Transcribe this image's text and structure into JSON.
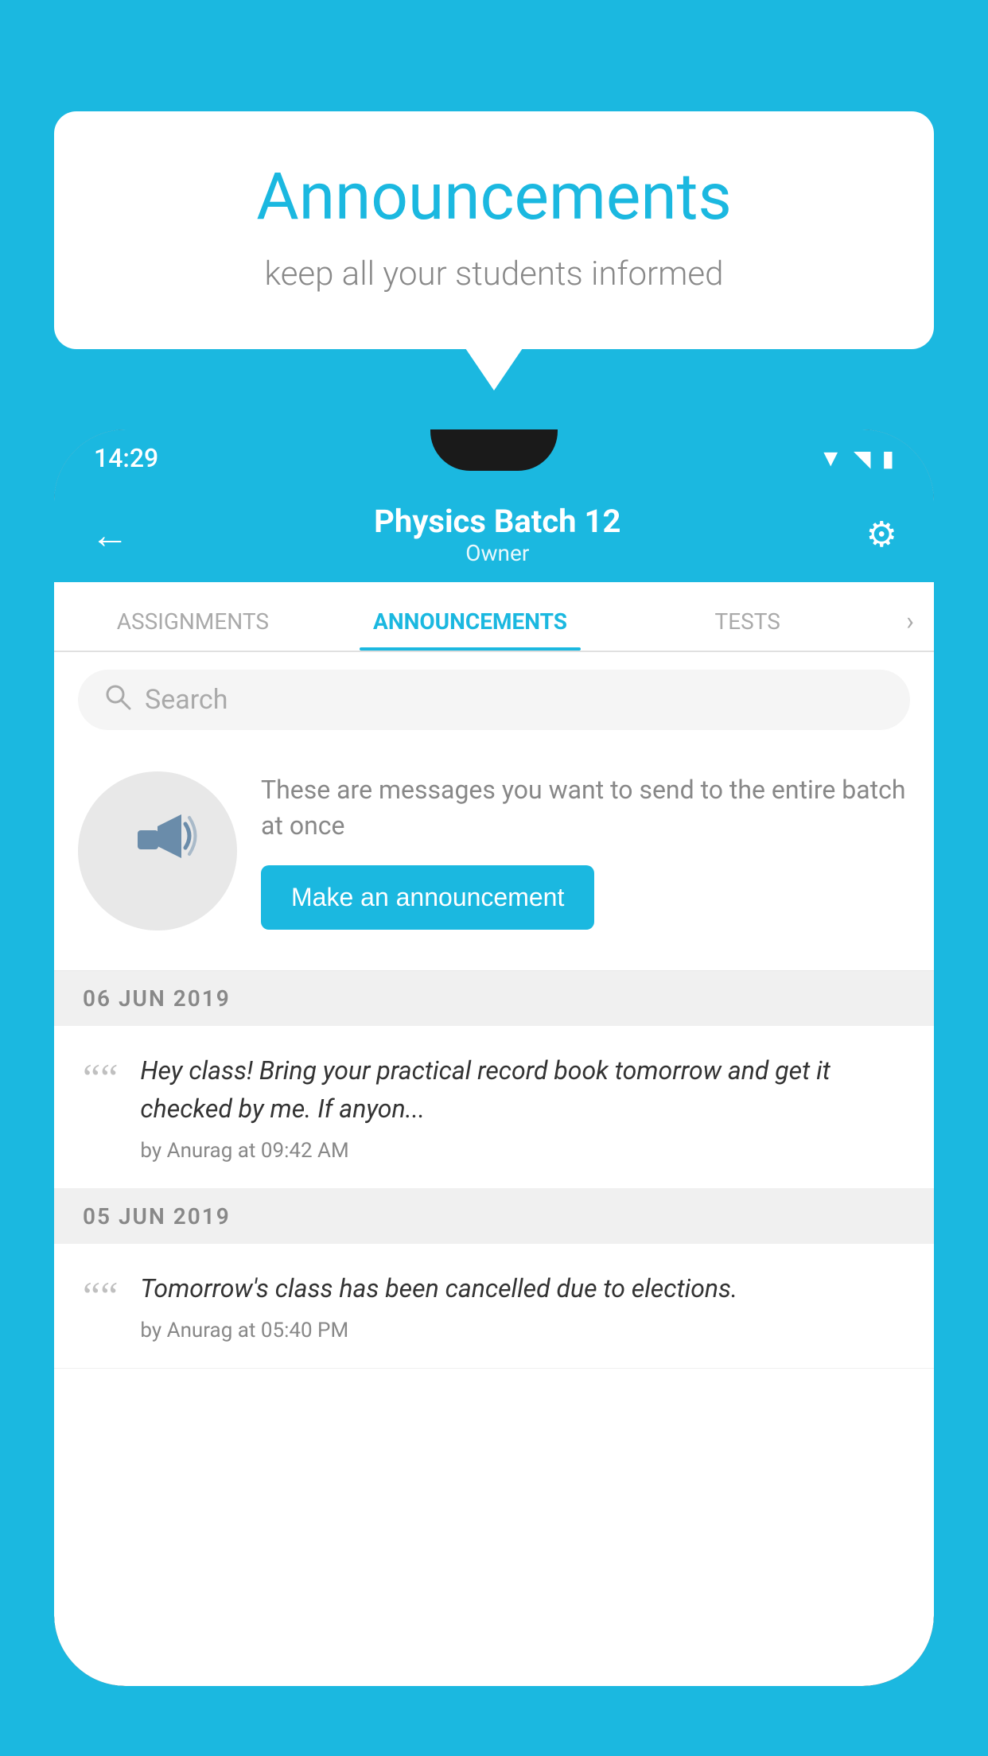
{
  "background_color": "#1bb8e0",
  "speech_bubble": {
    "title": "Announcements",
    "subtitle": "keep all your students informed"
  },
  "phone": {
    "status_bar": {
      "time": "14:29",
      "wifi": "▾",
      "signal": "▲",
      "battery": "▮"
    },
    "app_bar": {
      "title": "Physics Batch 12",
      "subtitle": "Owner",
      "back_label": "←",
      "gear_label": "⚙"
    },
    "tabs": [
      {
        "label": "ASSIGNMENTS",
        "active": false
      },
      {
        "label": "ANNOUNCEMENTS",
        "active": true
      },
      {
        "label": "TESTS",
        "active": false
      },
      {
        "label": "›",
        "active": false
      }
    ],
    "search": {
      "placeholder": "Search"
    },
    "promo": {
      "description": "These are messages you want to send to the entire batch at once",
      "button_label": "Make an announcement"
    },
    "announcements": [
      {
        "date": "06  JUN  2019",
        "text": "Hey class! Bring your practical record book tomorrow and get it checked by me. If anyon...",
        "meta": "by Anurag at 09:42 AM"
      },
      {
        "date": "05  JUN  2019",
        "text": "Tomorrow's class has been cancelled due to elections.",
        "meta": "by Anurag at 05:40 PM"
      }
    ]
  }
}
